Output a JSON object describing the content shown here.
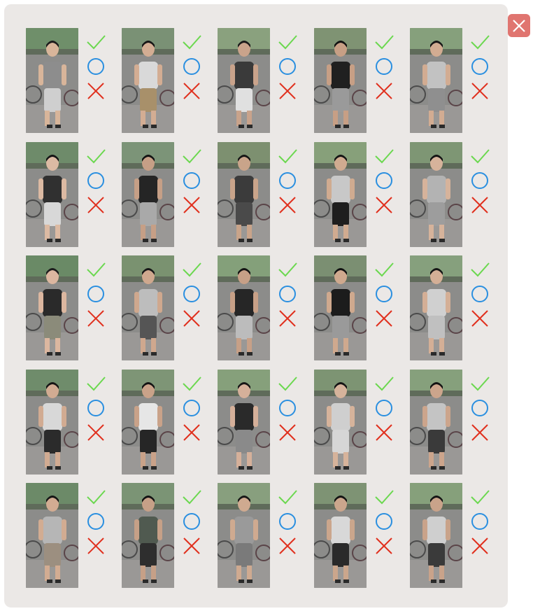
{
  "window": {
    "close_icon": "close-icon",
    "close_color": "#e07570"
  },
  "colors": {
    "panel": "#ebe8e6",
    "check": "#6bd84f",
    "circle": "#2a8fe0",
    "cross": "#e0301e"
  },
  "grid": {
    "rows": 5,
    "cols": 5,
    "cells": [
      {
        "shirt": "#8d8d8d",
        "pants": "#cfcfcf",
        "skin": "#d8b59a",
        "hair": "#1b1b1b",
        "bg": "#6f8f6a"
      },
      {
        "shirt": "#d9d9d9",
        "pants": "#a8906a",
        "skin": "#d3ad93",
        "hair": "#151515",
        "bg": "#7a9175"
      },
      {
        "shirt": "#3a3a3a",
        "pants": "#e0e0e0",
        "skin": "#c9a38b",
        "hair": "#1a1a1a",
        "bg": "#8aa17e"
      },
      {
        "shirt": "#202020",
        "pants": "#9a9a9a",
        "skin": "#c79f85",
        "hair": "#111111",
        "bg": "#7f9373"
      },
      {
        "shirt": "#c2c2c2",
        "pants": "#8f8f8f",
        "skin": "#d2ac92",
        "hair": "#161616",
        "bg": "#86a07c"
      },
      {
        "shirt": "#303030",
        "pants": "#d8d8d8",
        "skin": "#dcbaa3",
        "hair": "#141414",
        "bg": "#6e8b6a"
      },
      {
        "shirt": "#252525",
        "pants": "#a9a9a9",
        "skin": "#c69f86",
        "hair": "#121212",
        "bg": "#7c9478"
      },
      {
        "shirt": "#3b3b3b",
        "pants": "#4a4a4a",
        "skin": "#c9a48a",
        "hair": "#151515",
        "bg": "#7d9070"
      },
      {
        "shirt": "#c8c8c8",
        "pants": "#1e1e1e",
        "skin": "#d0ab90",
        "hair": "#141414",
        "bg": "#87a07a"
      },
      {
        "shirt": "#b3b3b3",
        "pants": "#9d9d9d",
        "skin": "#d6b39b",
        "hair": "#131313",
        "bg": "#7e9674"
      },
      {
        "shirt": "#2a2a2a",
        "pants": "#8b8b7a",
        "skin": "#dcb7a0",
        "hair": "#1c1c1c",
        "bg": "#6a8a66"
      },
      {
        "shirt": "#bdbdbd",
        "pants": "#555555",
        "skin": "#cfa88e",
        "hair": "#171717",
        "bg": "#7a9270"
      },
      {
        "shirt": "#262626",
        "pants": "#bcbcbc",
        "skin": "#c7a087",
        "hair": "#131313",
        "bg": "#84a07a"
      },
      {
        "shirt": "#1c1c1c",
        "pants": "#9a9a9a",
        "skin": "#cfa98e",
        "hair": "#111111",
        "bg": "#7b8f72"
      },
      {
        "shirt": "#d0d0d0",
        "pants": "#c0c0c0",
        "skin": "#d4af96",
        "hair": "#151515",
        "bg": "#86a07d"
      },
      {
        "shirt": "#d8d8d8",
        "pants": "#2b2b2b",
        "skin": "#d1ab92",
        "hair": "#151515",
        "bg": "#6f8c6b"
      },
      {
        "shirt": "#e6e6e6",
        "pants": "#262626",
        "skin": "#c9a289",
        "hair": "#131313",
        "bg": "#7e9576"
      },
      {
        "shirt": "#2a2a2a",
        "pants": "#8a8a8a",
        "skin": "#d5b09a",
        "hair": "#161616",
        "bg": "#86a07b"
      },
      {
        "shirt": "#cfcfcf",
        "pants": "#d6d6d6",
        "skin": "#d6b39b",
        "hair": "#141414",
        "bg": "#7d9473"
      },
      {
        "shirt": "#c4c4c4",
        "pants": "#3a3a3a",
        "skin": "#ccA58c",
        "hair": "#121212",
        "bg": "#86a07c"
      },
      {
        "shirt": "#b6b6b6",
        "pants": "#9c8f80",
        "skin": "#d2ac92",
        "hair": "#151515",
        "bg": "#6c8a68"
      },
      {
        "shirt": "#505a50",
        "pants": "#2e2e2e",
        "skin": "#c6a087",
        "hair": "#121212",
        "bg": "#7b9475"
      },
      {
        "shirt": "#9a9a9a",
        "pants": "#7a7a7a",
        "skin": "#cfaa90",
        "hair": "#171717",
        "bg": "#889f7e"
      },
      {
        "shirt": "#d8d8d8",
        "pants": "#2a2a2a",
        "skin": "#cba68c",
        "hair": "#131313",
        "bg": "#7e9374"
      },
      {
        "shirt": "#cfcfcf",
        "pants": "#3a3a3a",
        "skin": "#c9a38a",
        "hair": "#141414",
        "bg": "#86a07b"
      }
    ]
  }
}
